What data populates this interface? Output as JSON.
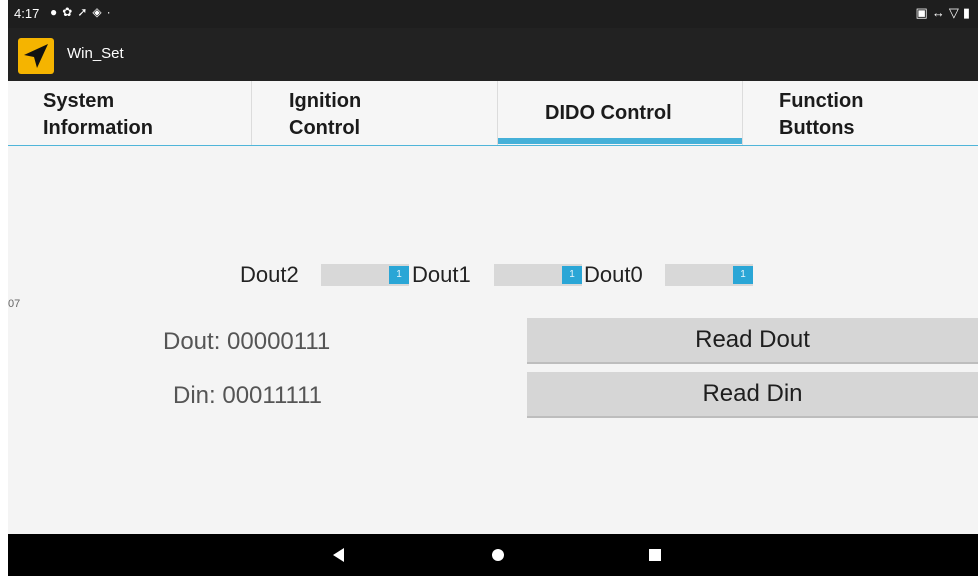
{
  "status_bar": {
    "time": "4:17",
    "left_icons": [
      "circle-app-icon",
      "gear-icon",
      "location-arrow-icon",
      "shield-icon",
      "dot-icon"
    ],
    "right_icons": [
      "nfc-icon",
      "swap-icon",
      "wifi-icon",
      "battery-icon"
    ]
  },
  "action_bar": {
    "title": "Win_Set",
    "icon": "navigation-arrow-icon",
    "icon_bg": "#f5b400"
  },
  "tabs": [
    {
      "line1": "System",
      "line2": "Information"
    },
    {
      "line1": "Ignition",
      "line2": "Control"
    },
    {
      "label": "DIDO Control",
      "selected": true
    },
    {
      "line1": "Function",
      "line2": "Buttons"
    }
  ],
  "douts": [
    {
      "label": "Dout2",
      "state": "1"
    },
    {
      "label": "Dout1",
      "state": "1"
    },
    {
      "label": "Dout0",
      "state": "1"
    }
  ],
  "side_value": "07",
  "readings": {
    "dout": "Dout: 00000111",
    "din": "Din: 00011111"
  },
  "buttons": {
    "read_dout": "Read Dout",
    "read_din": "Read Din"
  },
  "colors": {
    "accent": "#45b0d8",
    "toggle_on": "#2aa6d6"
  }
}
